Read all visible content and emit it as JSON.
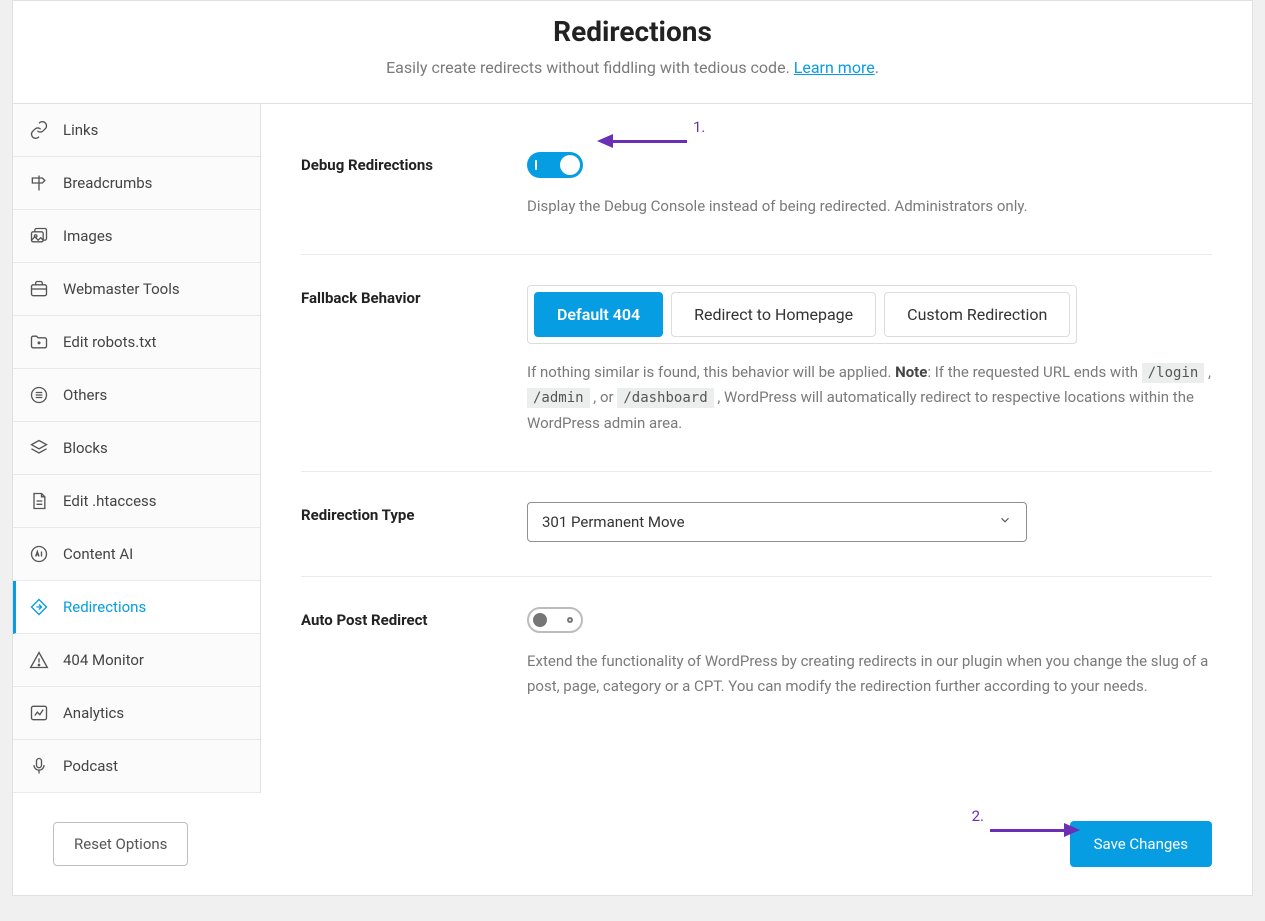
{
  "header": {
    "title": "Redirections",
    "subtitle_pre": "Easily create redirects without fiddling with tedious code. ",
    "learn_more": "Learn more",
    "subtitle_post": "."
  },
  "sidebar": {
    "items": [
      {
        "label": "Links"
      },
      {
        "label": "Breadcrumbs"
      },
      {
        "label": "Images"
      },
      {
        "label": "Webmaster Tools"
      },
      {
        "label": "Edit robots.txt"
      },
      {
        "label": "Others"
      },
      {
        "label": "Blocks"
      },
      {
        "label": "Edit .htaccess"
      },
      {
        "label": "Content AI"
      },
      {
        "label": "Redirections"
      },
      {
        "label": "404 Monitor"
      },
      {
        "label": "Analytics"
      },
      {
        "label": "Podcast"
      }
    ]
  },
  "rows": {
    "debug": {
      "label": "Debug Redirections",
      "desc": "Display the Debug Console instead of being redirected. Administrators only."
    },
    "fallback": {
      "label": "Fallback Behavior",
      "options": [
        "Default 404",
        "Redirect to Homepage",
        "Custom Redirection"
      ],
      "desc_pre": "If nothing similar is found, this behavior will be applied. ",
      "note": "Note",
      "desc_mid1": ": If the requested URL ends with ",
      "code1": "/login",
      "sep1": " , ",
      "code2": "/admin",
      "sep2": " , or ",
      "code3": "/dashboard",
      "desc_post": " , WordPress will automatically redirect to respective locations within the WordPress admin area."
    },
    "type": {
      "label": "Redirection Type",
      "value": "301 Permanent Move"
    },
    "auto": {
      "label": "Auto Post Redirect",
      "desc": "Extend the functionality of WordPress by creating redirects in our plugin when you change the slug of a post, page, category or a CPT. You can modify the redirection further according to your needs."
    }
  },
  "footer": {
    "reset": "Reset Options",
    "save": "Save Changes"
  },
  "annot": {
    "one": "1.",
    "two": "2."
  }
}
